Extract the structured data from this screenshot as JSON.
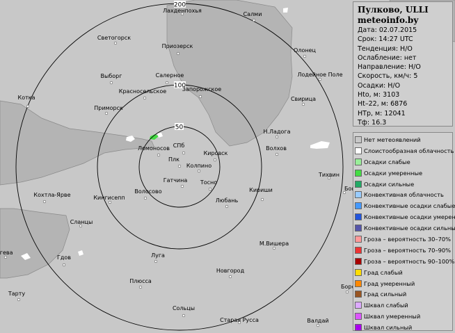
{
  "colors": {
    "background": "#c8c8c8",
    "water": "#b4b4b4",
    "ring": "#000000",
    "echo_green": "#44dd44",
    "echo_white": "#ffffff"
  },
  "rings": [
    {
      "label": "50"
    },
    {
      "label": "100"
    },
    {
      "label": "200"
    }
  ],
  "towns": [
    {
      "name": "Лахденпохья"
    },
    {
      "name": "Салми"
    },
    {
      "name": "Светогорск"
    },
    {
      "name": "Приозерск"
    },
    {
      "name": "Олонец"
    },
    {
      "name": "Выборг"
    },
    {
      "name": "Салерное"
    },
    {
      "name": "Лодейное Поле"
    },
    {
      "name": "Котка"
    },
    {
      "name": "Красносельское"
    },
    {
      "name": "Запорожское"
    },
    {
      "name": "Свирица"
    },
    {
      "name": "Приморск"
    },
    {
      "name": "Н.Ладога"
    },
    {
      "name": "Ломоносов"
    },
    {
      "name": "СПб"
    },
    {
      "name": "Волхов"
    },
    {
      "name": "Кировск"
    },
    {
      "name": "Плк"
    },
    {
      "name": "Колпино"
    },
    {
      "name": "Тихвин"
    },
    {
      "name": "Гатчина"
    },
    {
      "name": "Тосно"
    },
    {
      "name": "Бокситогорск"
    },
    {
      "name": "Кохтла-Ярве"
    },
    {
      "name": "Волосово"
    },
    {
      "name": "Кингисепп"
    },
    {
      "name": "Кириши"
    },
    {
      "name": "Любань"
    },
    {
      "name": "Сланцы"
    },
    {
      "name": "М.Вишера"
    },
    {
      "name": "ыгева"
    },
    {
      "name": "Гдов"
    },
    {
      "name": "Луга"
    },
    {
      "name": "Новгород"
    },
    {
      "name": "Плюсса"
    },
    {
      "name": "Боро"
    },
    {
      "name": "Тарту"
    },
    {
      "name": "Сольцы"
    },
    {
      "name": "Старая Русса"
    },
    {
      "name": "Валдай"
    }
  ],
  "info": {
    "station": "Пулково, ULLI",
    "site": "meteoinfo.by",
    "rows": [
      "Дата: 02.07.2015",
      "Срок: 14:27 UTC",
      "Тенденция: Н/О",
      "Ослабление: нет",
      "Направление: Н/О",
      "Скорость, км/ч: 5",
      "Осадки: Н/О",
      "Hto, м: 3103",
      "Ht–22, м: 6876",
      "HTp, м: 12041",
      "Тф: 16.3"
    ]
  },
  "legend": [
    {
      "label": "Нет метеоявлений",
      "color": "#c8c8c8"
    },
    {
      "label": "Слоистообразная облачность",
      "color": "#ffffff"
    },
    {
      "label": "Осадки слабые",
      "color": "#99ee99"
    },
    {
      "label": "Осадки умеренные",
      "color": "#44dd44"
    },
    {
      "label": "Осадки сильные",
      "color": "#22aa66"
    },
    {
      "label": "Конвективная облачность",
      "color": "#99ccff"
    },
    {
      "label": "Конвективные осадки слабые",
      "color": "#4499ff"
    },
    {
      "label": "Конвективные осадки умерен.",
      "color": "#2255dd"
    },
    {
      "label": "Конвективные осадки сильные",
      "color": "#5555aa"
    },
    {
      "label": "Гроза – вероятность 30–70%",
      "color": "#ff9999"
    },
    {
      "label": "Гроза – вероятность 70–90%",
      "color": "#ee3333"
    },
    {
      "label": "Гроза – вероятность 90–100%",
      "color": "#aa0000"
    },
    {
      "label": "Град слабый",
      "color": "#ffdd00"
    },
    {
      "label": "Град умеренный",
      "color": "#ff8800"
    },
    {
      "label": "Град сильный",
      "color": "#995522"
    },
    {
      "label": "Шквал слабый",
      "color": "#ddaaff"
    },
    {
      "label": "Шквал умеренный",
      "color": "#dd55ff"
    },
    {
      "label": "Шквал сильный",
      "color": "#aa00ee"
    }
  ]
}
